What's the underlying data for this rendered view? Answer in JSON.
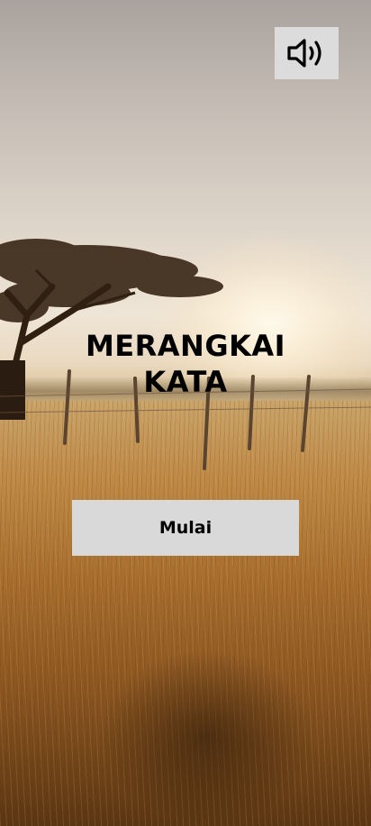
{
  "game": {
    "title_line1": "MERANGKAI",
    "title_line2": "KATA",
    "start_label": "Mulai"
  },
  "controls": {
    "sound_icon": "speaker-volume-icon",
    "sound_state": "on"
  },
  "colors": {
    "button_bg": "#d9d9d9",
    "title_text": "#000000"
  }
}
